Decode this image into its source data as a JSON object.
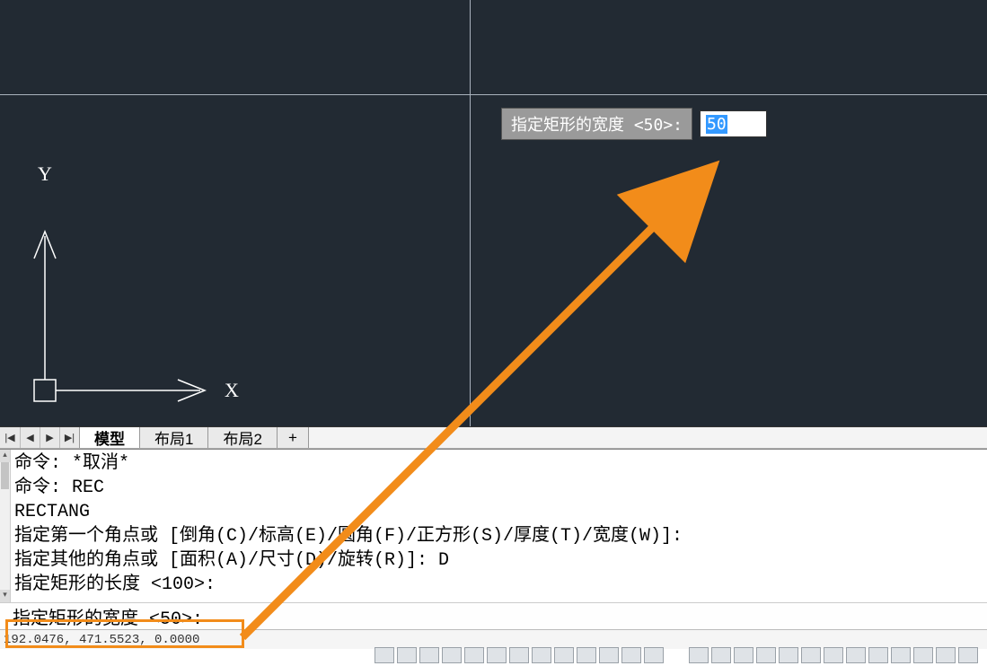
{
  "viewport": {
    "ucs": {
      "x_label": "X",
      "y_label": "Y"
    },
    "dynamic_input": {
      "prompt": "指定矩形的宽度 <50>:",
      "value": "50"
    }
  },
  "tabs": {
    "items": [
      {
        "label": "模型",
        "active": true
      },
      {
        "label": "布局1",
        "active": false
      },
      {
        "label": "布局2",
        "active": false
      }
    ],
    "add_label": "+"
  },
  "command_history": [
    "命令: *取消*",
    "命令: REC",
    "RECTANG",
    "指定第一个角点或 [倒角(C)/标高(E)/圆角(F)/正方形(S)/厚度(T)/宽度(W)]:",
    "指定其他的角点或 [面积(A)/尺寸(D)/旋转(R)]: D",
    "指定矩形的长度 <100>:",
    ""
  ],
  "command_line": {
    "prompt": "指定矩形的宽度 <50>:",
    "value": ""
  },
  "status": {
    "coords": "192.0476, 471.5523, 0.0000"
  },
  "colors": {
    "viewport_bg": "#222a33",
    "accent": "#f28c1a",
    "select_bg": "#3399ff"
  }
}
